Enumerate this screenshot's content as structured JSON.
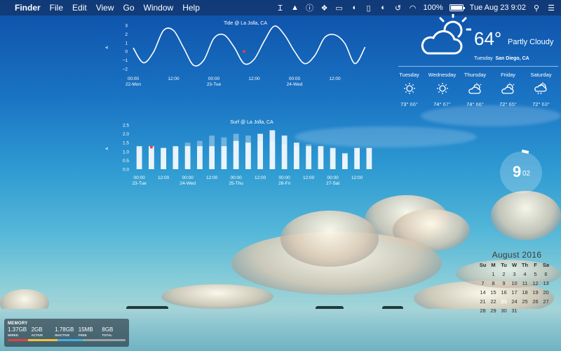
{
  "menubar": {
    "apple_icon": "apple-icon",
    "app_name": "Finder",
    "menus": [
      "File",
      "Edit",
      "View",
      "Go",
      "Window",
      "Help"
    ],
    "status_icons": [
      "text-cursor-icon",
      "drive-icon",
      "info-icon",
      "dropbox-icon",
      "display-icon",
      "speaker-icon",
      "phone-icon",
      "moon-icon",
      "time-machine-icon",
      "wifi-icon"
    ],
    "battery": "100%",
    "clock": "Tue Aug 23  9:02",
    "menu_extras": [
      "search-icon",
      "notification-center-icon"
    ]
  },
  "tide_chart": {
    "title": "Tide @ La Jolla, CA",
    "yticks": [
      "3",
      "2",
      "1",
      "0",
      "−1",
      "−2"
    ],
    "xticks": [
      {
        "time": "00:00",
        "date": "22-Mon"
      },
      {
        "time": "12:00",
        "date": ""
      },
      {
        "time": "00:00",
        "date": "23-Tue"
      },
      {
        "time": "12:00",
        "date": ""
      },
      {
        "time": "00:00",
        "date": "24-Wed"
      },
      {
        "time": "12:00",
        "date": ""
      }
    ]
  },
  "surf_chart": {
    "title": "Surf @ La Jolla, CA",
    "yticks": [
      "2.5",
      "2.0",
      "1.5",
      "1.0",
      "0.5",
      "0.0"
    ],
    "xticks": [
      {
        "time": "00:00",
        "date": "23-Tue"
      },
      {
        "time": "12:00",
        "date": ""
      },
      {
        "time": "00:00",
        "date": "24-Wed"
      },
      {
        "time": "12:00",
        "date": ""
      },
      {
        "time": "00:00",
        "date": "25-Thu"
      },
      {
        "time": "12:00",
        "date": ""
      },
      {
        "time": "00:00",
        "date": "26-Fri"
      },
      {
        "time": "12:00",
        "date": ""
      },
      {
        "time": "00:00",
        "date": "27-Sat"
      },
      {
        "time": "12:00",
        "date": ""
      }
    ]
  },
  "chart_data": [
    {
      "type": "line",
      "title": "Tide @ La Jolla, CA",
      "xlabel": "",
      "ylabel": "",
      "ylim": [
        -2,
        3
      ],
      "x_hours": [
        0,
        3,
        6,
        9,
        12,
        15,
        18,
        21,
        24,
        27,
        30,
        33,
        36,
        39,
        42,
        45,
        48,
        51,
        54,
        57,
        60,
        63,
        66,
        69
      ],
      "x": [
        "22-Mon 00:00",
        "22-Mon 03:00",
        "22-Mon 06:00",
        "22-Mon 09:00",
        "22-Mon 12:00",
        "22-Mon 15:00",
        "22-Mon 18:00",
        "22-Mon 21:00",
        "23-Tue 00:00",
        "23-Tue 03:00",
        "23-Tue 06:00",
        "23-Tue 09:00",
        "23-Tue 12:00",
        "23-Tue 15:00",
        "23-Tue 18:00",
        "23-Tue 21:00",
        "24-Wed 00:00",
        "24-Wed 03:00",
        "24-Wed 06:00",
        "24-Wed 09:00",
        "24-Wed 12:00",
        "24-Wed 15:00",
        "24-Wed 18:00",
        "24-Wed 21:00"
      ],
      "values": [
        0.4,
        -1.3,
        -0.1,
        2.4,
        2.4,
        0.4,
        -1.6,
        -1.0,
        1.5,
        1.9,
        0.5,
        -1.4,
        -0.9,
        1.2,
        2.9,
        1.9,
        0.0,
        -1.4,
        -0.5,
        1.6,
        1.9,
        0.9,
        -1.4,
        0.5
      ],
      "grid": false
    },
    {
      "type": "bar",
      "title": "Surf @ La Jolla, CA",
      "xlabel": "",
      "ylabel": "",
      "ylim": [
        0,
        2.5
      ],
      "categories": [
        "23-Tue 00:00",
        "23-Tue 06:00",
        "23-Tue 12:00",
        "23-Tue 18:00",
        "24-Wed 00:00",
        "24-Wed 06:00",
        "24-Wed 12:00",
        "24-Wed 18:00",
        "25-Thu 00:00",
        "25-Thu 06:00",
        "25-Thu 12:00",
        "25-Thu 18:00",
        "26-Fri 00:00",
        "26-Fri 06:00",
        "26-Fri 12:00",
        "26-Fri 18:00",
        "27-Sat 00:00",
        "27-Sat 06:00",
        "27-Sat 12:00",
        "27-Sat 18:00"
      ],
      "series": [
        {
          "values": [
            1.3,
            1.3,
            1.2,
            1.3,
            1.3,
            1.3,
            1.3,
            1.3,
            1.6,
            1.5,
            2.0,
            2.2,
            1.9,
            1.5,
            1.3,
            1.3,
            1.2,
            0.9,
            1.2,
            1.2
          ]
        },
        {
          "values": [
            1.2,
            1.1,
            1.2,
            1.2,
            1.5,
            1.6,
            1.9,
            1.8,
            2.0,
            1.9,
            1.6,
            1.6,
            1.4,
            1.3,
            1.4,
            1.3,
            1.1,
            0.8,
            1.2,
            1.2
          ]
        }
      ],
      "grid": false
    }
  ],
  "weather": {
    "temperature": "64°",
    "condition": "Partly Cloudy",
    "icon": "partly-cloudy-icon",
    "day": "Tuesday",
    "location": "San Diego, CA",
    "forecast": [
      {
        "day": "Tuesday",
        "icon": "sunny-icon",
        "high": "73°",
        "low": "66°"
      },
      {
        "day": "Wednesday",
        "icon": "sunny-icon",
        "high": "74°",
        "low": "67°"
      },
      {
        "day": "Thursday",
        "icon": "partly-cloudy-icon",
        "high": "74°",
        "low": "66°"
      },
      {
        "day": "Friday",
        "icon": "partly-cloudy-icon",
        "high": "72°",
        "low": "65°"
      },
      {
        "day": "Saturday",
        "icon": "partly-cloudy-rain-icon",
        "high": "72°",
        "low": "63°"
      }
    ]
  },
  "clock": {
    "hour": "9",
    "minute": "02",
    "minute_fraction": 0.033
  },
  "calendar": {
    "title": "August 2016",
    "weekdays": [
      "Su",
      "M",
      "Tu",
      "W",
      "Th",
      "F",
      "Sa"
    ],
    "weeks": [
      [
        "",
        "1",
        "2",
        "3",
        "4",
        "5",
        "6"
      ],
      [
        "7",
        "8",
        "9",
        "10",
        "11",
        "12",
        "13"
      ],
      [
        "14",
        "15",
        "16",
        "17",
        "18",
        "19",
        "20"
      ],
      [
        "21",
        "22",
        "23",
        "24",
        "25",
        "26",
        "27"
      ],
      [
        "28",
        "29",
        "30",
        "31",
        "",
        "",
        ""
      ]
    ],
    "today": "23"
  },
  "memory": {
    "title": "MEMORY",
    "stats": [
      {
        "value": "1.37GB",
        "label": "WIRED"
      },
      {
        "value": "2GB",
        "label": "ACTIVE"
      },
      {
        "value": "1.78GB",
        "label": "INACTIVE"
      },
      {
        "value": "15MB",
        "label": "FREE"
      },
      {
        "value": "8GB",
        "label": "TOTAL"
      }
    ],
    "bar": [
      {
        "fraction": 0.171,
        "color": "#e0443a"
      },
      {
        "fraction": 0.25,
        "color": "#f0c23a"
      },
      {
        "fraction": 0.222,
        "color": "#3fb0e8"
      },
      {
        "fraction": 0.002,
        "color": "#7fd35a"
      }
    ]
  }
}
